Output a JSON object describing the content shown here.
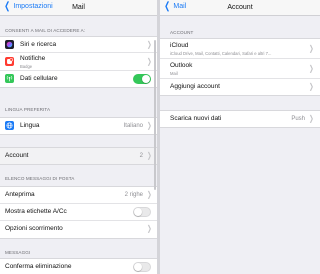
{
  "left": {
    "back_label": "Impostazioni",
    "title": "Mail",
    "section_access": "CONSENTI A MAIL DI ACCEDERE A:",
    "siri_label": "Siri e ricerca",
    "notifications_label": "Notifiche",
    "notifications_sub": "Badge",
    "cellular_label": "Dati cellulare",
    "section_language": "LINGUA PREFERITA",
    "language_label": "Lingua",
    "language_value": "Italiano",
    "account_label": "Account",
    "account_value": "2",
    "section_list": "ELENCO MESSAGGI DI POSTA",
    "preview_label": "Anteprima",
    "preview_value": "2 righe",
    "show_cc_label": "Mostra etichette A/Cc",
    "swipe_label": "Opzioni scorrimento",
    "section_messages": "MESSAGGI",
    "confirm_delete_label": "Conferma eliminazione",
    "cellular_enabled": true,
    "show_cc_enabled": false,
    "confirm_delete_enabled": false
  },
  "right": {
    "back_label": "Mail",
    "title": "Account",
    "section_account": "ACCOUNT",
    "icloud_label": "iCloud",
    "icloud_sub": "iCloud Drive, Mail, Contatti, Calendari, Safari e altri 7...",
    "outlook_label": "Outlook",
    "outlook_sub": "Mail",
    "add_account_label": "Aggiungi account",
    "fetch_label": "Scarica nuovi dati",
    "fetch_value": "Push"
  },
  "colors": {
    "accent": "#1b7bf6",
    "toggle_on": "#34c759",
    "siri_icon": "#1d1d2b",
    "notifications_icon": "#ff3b30",
    "cellular_icon": "#34c759",
    "language_icon": "#1b7bf6"
  },
  "icons": {
    "back": "chevron-left-icon",
    "disclosure": "chevron-right-icon",
    "siri": "siri-icon",
    "notifications": "notifications-icon",
    "cellular": "cellular-antenna-icon",
    "language": "globe-icon"
  }
}
